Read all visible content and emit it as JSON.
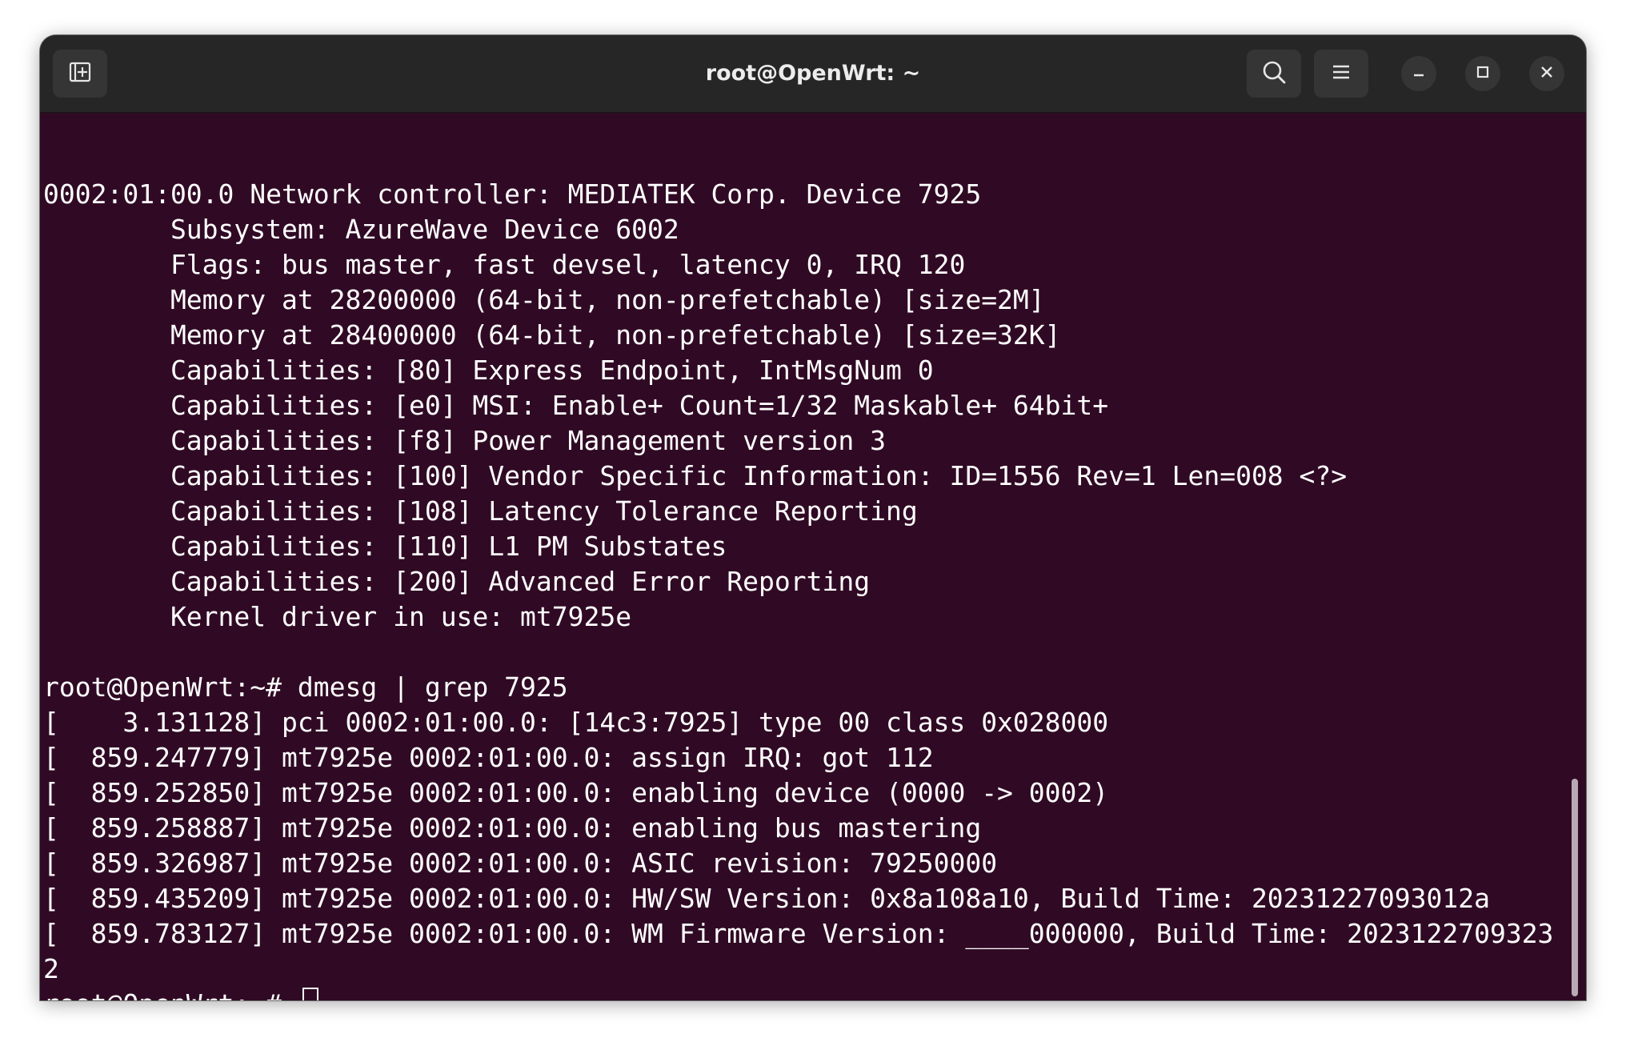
{
  "window": {
    "title": "root@OpenWrt: ~"
  },
  "icons": {
    "new_tab": "new-tab-icon",
    "search": "search-icon",
    "menu": "hamburger-menu-icon",
    "minimize": "minimize-icon",
    "maximize": "maximize-icon",
    "close": "close-icon"
  },
  "colors": {
    "terminal_background": "#300a24",
    "titlebar_background": "#262626",
    "text": "#ffffff"
  },
  "terminal": {
    "lines": [
      "",
      "0002:01:00.0 Network controller: MEDIATEK Corp. Device 7925",
      "        Subsystem: AzureWave Device 6002",
      "        Flags: bus master, fast devsel, latency 0, IRQ 120",
      "        Memory at 28200000 (64-bit, non-prefetchable) [size=2M]",
      "        Memory at 28400000 (64-bit, non-prefetchable) [size=32K]",
      "        Capabilities: [80] Express Endpoint, IntMsgNum 0",
      "        Capabilities: [e0] MSI: Enable+ Count=1/32 Maskable+ 64bit+",
      "        Capabilities: [f8] Power Management version 3",
      "        Capabilities: [100] Vendor Specific Information: ID=1556 Rev=1 Len=008 <?>",
      "        Capabilities: [108] Latency Tolerance Reporting",
      "        Capabilities: [110] L1 PM Substates",
      "        Capabilities: [200] Advanced Error Reporting",
      "        Kernel driver in use: mt7925e",
      "",
      "root@OpenWrt:~# dmesg | grep 7925",
      "[    3.131128] pci 0002:01:00.0: [14c3:7925] type 00 class 0x028000",
      "[  859.247779] mt7925e 0002:01:00.0: assign IRQ: got 112",
      "[  859.252850] mt7925e 0002:01:00.0: enabling device (0000 -> 0002)",
      "[  859.258887] mt7925e 0002:01:00.0: enabling bus mastering",
      "[  859.326987] mt7925e 0002:01:00.0: ASIC revision: 79250000",
      "[  859.435209] mt7925e 0002:01:00.0: HW/SW Version: 0x8a108a10, Build Time: 20231227093012a",
      "[  859.783127] mt7925e 0002:01:00.0: WM Firmware Version: ____000000, Build Time: 2023122709323",
      "2"
    ],
    "prompt": "root@OpenWrt:~# "
  }
}
